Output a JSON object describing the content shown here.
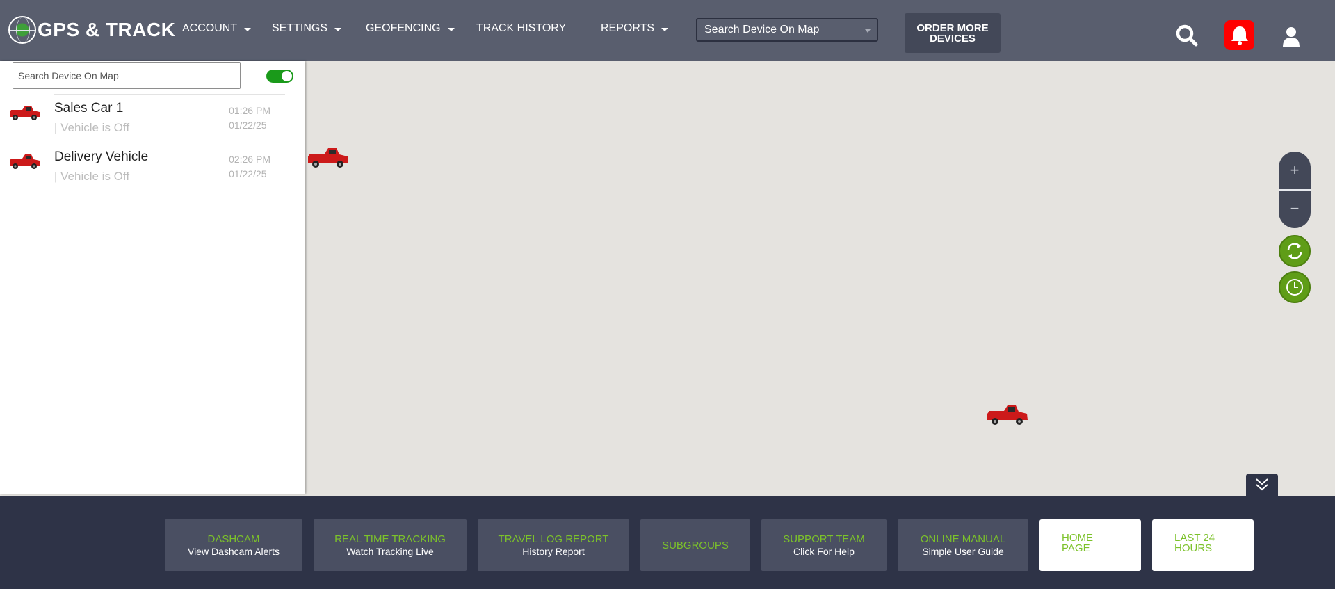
{
  "app": {
    "logo_text": "GPS & TRACK"
  },
  "nav": {
    "account": "ACCOUNT",
    "settings": "SETTINGS",
    "geofencing": "GEOFENCING",
    "track_history": "TRACK HISTORY",
    "reports": "REPORTS"
  },
  "header": {
    "device_search_value": "Search Device On Map",
    "order_line1": "ORDER MORE",
    "order_line2": "DEVICES"
  },
  "panel": {
    "search_placeholder": "Search Device On Map",
    "toggle_on": true,
    "devices": [
      {
        "name": "Sales Car 1",
        "status": "| Vehicle is Off",
        "time": "01:26 PM",
        "date": "01/22/25"
      },
      {
        "name": "Delivery Vehicle",
        "status": "| Vehicle is Off",
        "time": "02:26 PM",
        "date": "01/22/25"
      }
    ]
  },
  "map": {
    "zoom_in": "+",
    "zoom_out": "−"
  },
  "bottom": {
    "buttons": [
      {
        "title": "DASHCAM",
        "sub": "View Dashcam Alerts"
      },
      {
        "title": "REAL TIME TRACKING",
        "sub": "Watch Tracking Live"
      },
      {
        "title": "TRAVEL LOG REPORT",
        "sub": "History Report"
      },
      {
        "title": "SUBGROUPS",
        "sub": ""
      },
      {
        "title": "SUPPORT TEAM",
        "sub": "Click For Help"
      },
      {
        "title": "ONLINE MANUAL",
        "sub": "Simple User Guide"
      }
    ],
    "home_page": "HOME\nPAGE",
    "last_24_hours": "LAST 24\nHOURS"
  },
  "colors": {
    "topbar": "#595e6e",
    "bottombar": "#2e3347",
    "accent_green": "#7cc22a",
    "alert_red": "#ff0000",
    "map_bg": "#e5e3df"
  },
  "icons": [
    "globe-logo-icon",
    "caret-down-icon",
    "search-icon",
    "bell-icon",
    "user-icon",
    "pickup-truck-icon",
    "refresh-icon",
    "clock-icon",
    "chevrons-down-icon"
  ]
}
